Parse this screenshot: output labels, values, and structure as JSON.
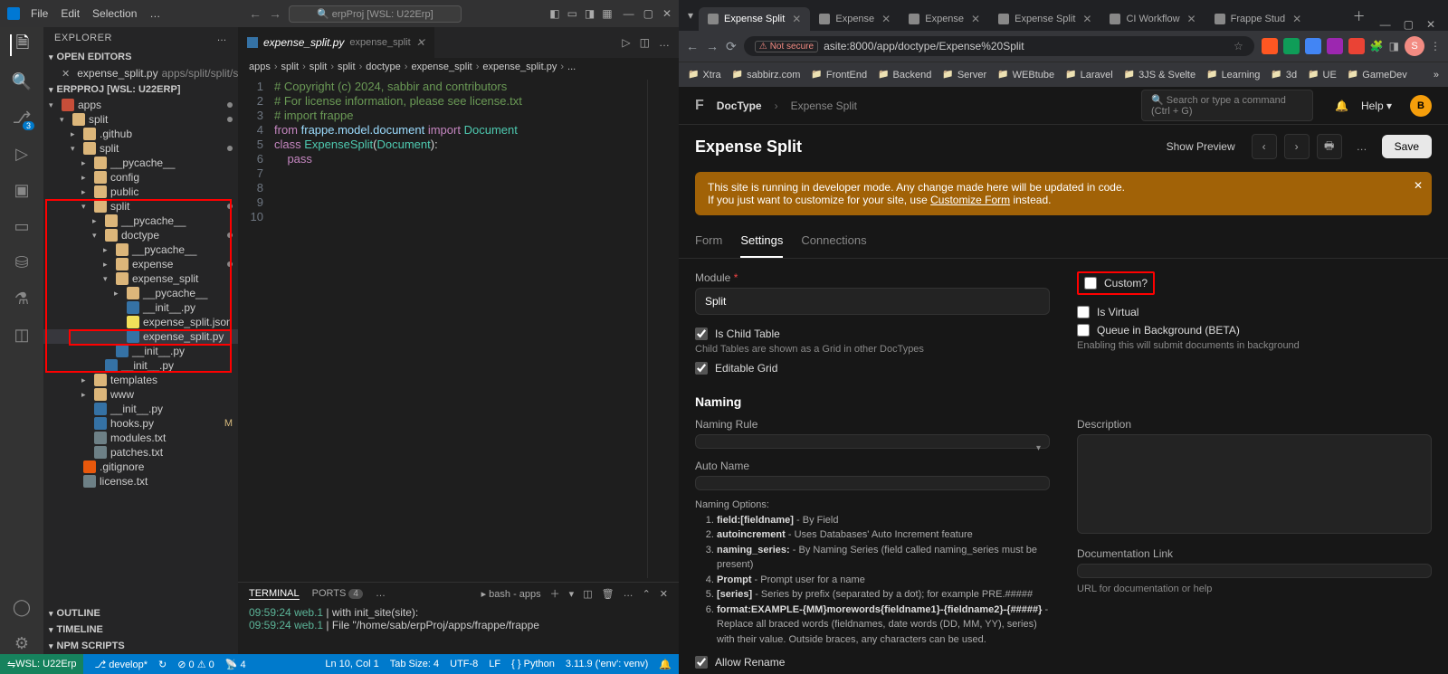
{
  "vscode": {
    "menus": [
      "File",
      "Edit",
      "Selection"
    ],
    "titleSearch": "erpProj [WSL: U22Erp]",
    "explorer": {
      "title": "EXPLORER",
      "openEditors": "OPEN EDITORS",
      "project": "ERPPROJ [WSL: U22ERP]",
      "outline": "OUTLINE",
      "timeline": "TIMELINE",
      "npm": "NPM SCRIPTS"
    },
    "openFile": {
      "name": "expense_split.py",
      "path": "apps/split/split/s..."
    },
    "tree": [
      {
        "d": 0,
        "t": "folder-red",
        "n": "apps",
        "open": true,
        "dot": true
      },
      {
        "d": 1,
        "t": "folder",
        "n": "split",
        "open": true,
        "dot": true
      },
      {
        "d": 2,
        "t": "folder",
        "n": ".github",
        "open": false
      },
      {
        "d": 2,
        "t": "folder",
        "n": "split",
        "open": true,
        "dot": true
      },
      {
        "d": 3,
        "t": "folder",
        "n": "__pycache__",
        "open": false
      },
      {
        "d": 3,
        "t": "folder",
        "n": "config",
        "open": false
      },
      {
        "d": 3,
        "t": "folder",
        "n": "public",
        "open": false
      },
      {
        "d": 3,
        "t": "folder",
        "n": "split",
        "open": true,
        "dot": true
      },
      {
        "d": 4,
        "t": "folder",
        "n": "__pycache__",
        "open": false
      },
      {
        "d": 4,
        "t": "folder",
        "n": "doctype",
        "open": true,
        "dot": true
      },
      {
        "d": 5,
        "t": "folder",
        "n": "__pycache__",
        "open": false
      },
      {
        "d": 5,
        "t": "folder",
        "n": "expense",
        "open": false,
        "dot": true
      },
      {
        "d": 5,
        "t": "folder",
        "n": "expense_split",
        "open": true
      },
      {
        "d": 6,
        "t": "folder",
        "n": "__pycache__",
        "open": false
      },
      {
        "d": 6,
        "t": "py",
        "n": "__init__.py"
      },
      {
        "d": 6,
        "t": "json",
        "n": "expense_split.json"
      },
      {
        "d": 6,
        "t": "py",
        "n": "expense_split.py",
        "active": true
      },
      {
        "d": 5,
        "t": "py",
        "n": "__init__.py"
      },
      {
        "d": 4,
        "t": "py",
        "n": "__init__.py"
      },
      {
        "d": 3,
        "t": "folder",
        "n": "templates",
        "open": false
      },
      {
        "d": 3,
        "t": "folder",
        "n": "www",
        "open": false
      },
      {
        "d": 3,
        "t": "py",
        "n": "__init__.py"
      },
      {
        "d": 3,
        "t": "py",
        "n": "hooks.py",
        "m": "M"
      },
      {
        "d": 3,
        "t": "txt",
        "n": "modules.txt"
      },
      {
        "d": 3,
        "t": "txt",
        "n": "patches.txt"
      },
      {
        "d": 2,
        "t": "git",
        "n": ".gitignore"
      },
      {
        "d": 2,
        "t": "txt",
        "n": "license.txt"
      }
    ],
    "tab": {
      "name": "expense_split.py",
      "folder": "expense_split"
    },
    "breadcrumb": [
      "apps",
      "split",
      "split",
      "split",
      "doctype",
      "expense_split",
      "expense_split.py",
      "..."
    ],
    "code": [
      {
        "n": 1,
        "c": "comment",
        "t": "# Copyright (c) 2024, sabbir and contributors"
      },
      {
        "n": 2,
        "c": "comment",
        "t": "# For license information, please see license.txt"
      },
      {
        "n": 3,
        "c": "",
        "t": ""
      },
      {
        "n": 4,
        "c": "comment",
        "t": "# import frappe"
      },
      {
        "n": 5,
        "c": "mixed",
        "t": "from frappe.model.document import Document"
      },
      {
        "n": 6,
        "c": "",
        "t": ""
      },
      {
        "n": 7,
        "c": "",
        "t": ""
      },
      {
        "n": 8,
        "c": "mixed2",
        "t": "class ExpenseSplit(Document):"
      },
      {
        "n": 9,
        "c": "keyword",
        "t": "    pass"
      },
      {
        "n": 10,
        "c": "",
        "t": ""
      }
    ],
    "terminal": {
      "tabs": [
        "TERMINAL",
        "PORTS"
      ],
      "portsBadge": "4",
      "shell": "bash - apps",
      "lines": [
        {
          "ts": "09:59:24",
          "src": "web.1",
          "txt": "|   with init_site(site):"
        },
        {
          "ts": "09:59:24",
          "src": "web.1",
          "txt": "|   File \"/home/sab/erpProj/apps/frappe/frappe"
        }
      ]
    },
    "status": {
      "wsl": "WSL: U22Erp",
      "branch": "develop*",
      "errors": "0",
      "warnings": "0",
      "ports": "4",
      "cursor": "Ln 10, Col 1",
      "tab": "Tab Size: 4",
      "enc": "UTF-8",
      "eol": "LF",
      "lang": "Python",
      "env": "3.11.9 ('env': venv)"
    }
  },
  "chrome": {
    "tabs": [
      {
        "label": "Expense Split",
        "active": true
      },
      {
        "label": "Expense"
      },
      {
        "label": "Expense"
      },
      {
        "label": "Expense Split"
      },
      {
        "label": "CI Workflow"
      },
      {
        "label": "Frappe Stud"
      }
    ],
    "url": {
      "insecure": "Not secure",
      "path": "asite:8000/app/doctype/Expense%20Split"
    },
    "bookmarks": [
      "Xtra",
      "sabbirz.com",
      "FrontEnd",
      "Backend",
      "Server",
      "WEBtube",
      "Laravel",
      "3JS & Svelte",
      "Learning",
      "3d",
      "UE",
      "GameDev"
    ],
    "avatar": "S"
  },
  "frappe": {
    "breadcrumb": {
      "root": "DocType",
      "current": "Expense Split"
    },
    "searchPlaceholder": "Search or type a command (Ctrl + G)",
    "help": "Help",
    "userInitial": "B",
    "title": "Expense Split",
    "actions": {
      "preview": "Show Preview",
      "save": "Save"
    },
    "alert": {
      "line1": "This site is running in developer mode. Any change made here will be updated in code.",
      "line2a": "If you just want to customize for your site, use ",
      "link": "Customize Form",
      "line2b": " instead."
    },
    "tabs": [
      "Form",
      "Settings",
      "Connections"
    ],
    "activeTab": 1,
    "module": {
      "label": "Module",
      "value": "Split"
    },
    "checks": {
      "custom": "Custom?",
      "virtual": "Is Virtual",
      "queue": "Queue in Background (BETA)",
      "queueHint": "Enabling this will submit documents in background",
      "child": "Is Child Table",
      "childHint": "Child Tables are shown as a Grid in other DocTypes",
      "editable": "Editable Grid",
      "rename": "Allow Rename"
    },
    "naming": {
      "title": "Naming",
      "rule": "Naming Rule",
      "autoName": "Auto Name",
      "desc": "Description",
      "docLink": "Documentation Link",
      "docHint": "URL for documentation or help",
      "optsTitle": "Naming Options:",
      "opts": [
        "<b>field:[fieldname]</b> - By Field",
        "<b>autoincrement</b> - Uses Databases' Auto Increment feature",
        "<b>naming_series:</b> - By Naming Series (field called naming_series must be present)",
        "<b>Prompt</b> - Prompt user for a name",
        "<b>[series]</b> - Series by prefix (separated by a dot); for example PRE.#####",
        "<b>format:EXAMPLE-{MM}morewords{fieldname1}-{fieldname2}-{#####}</b> - Replace all braced words (fieldnames, date words (DD, MM, YY), series) with their value. Outside braces, any characters can be used."
      ]
    }
  }
}
